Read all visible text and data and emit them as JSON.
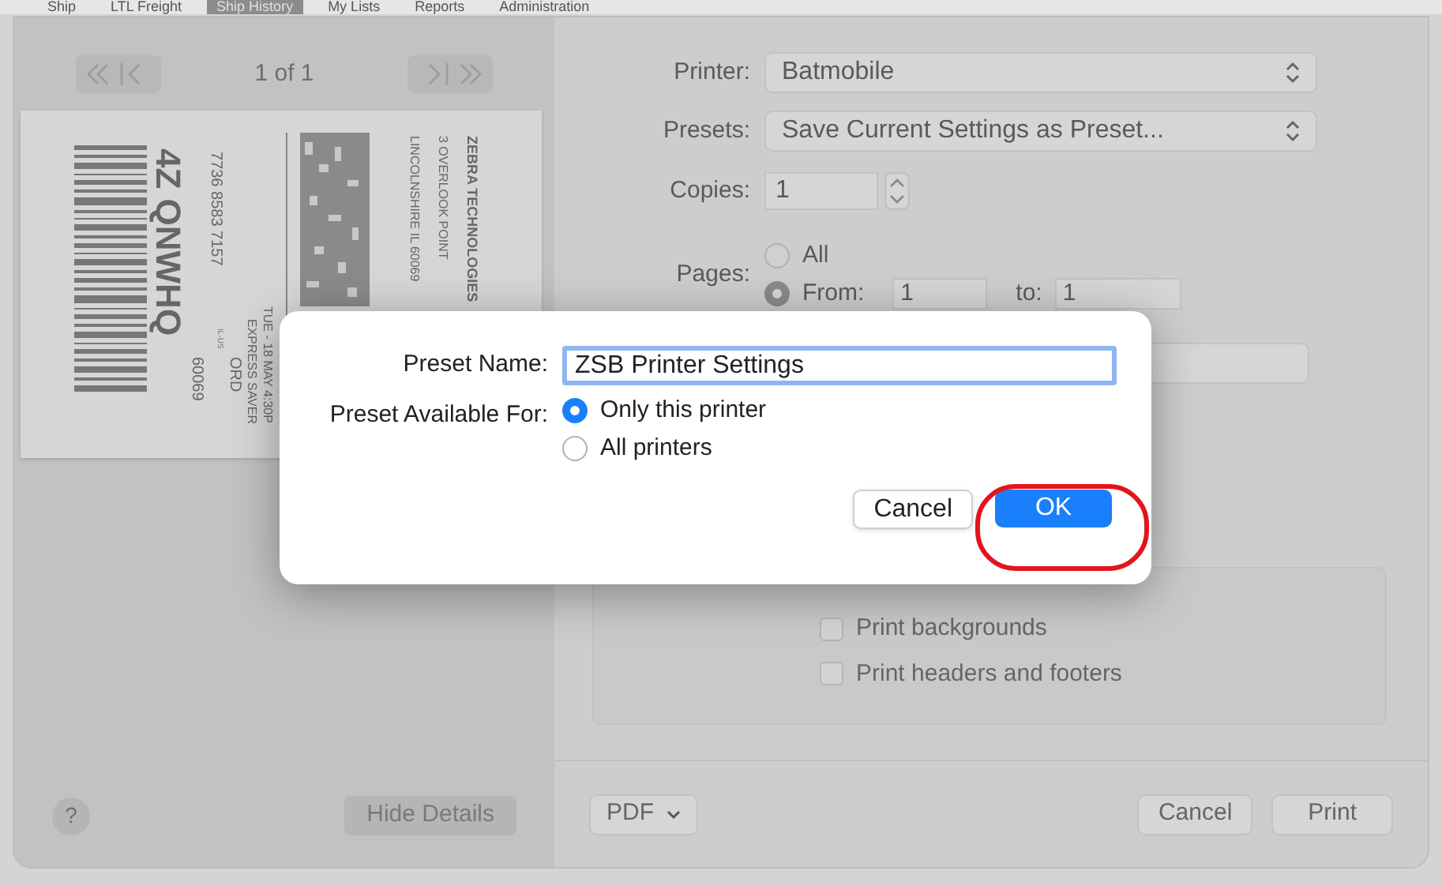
{
  "top_tabs": [
    {
      "label": "Ship",
      "selected": false
    },
    {
      "label": "LTL Freight",
      "selected": false
    },
    {
      "label": "Ship History",
      "selected": true
    },
    {
      "label": "My Lists",
      "selected": false
    },
    {
      "label": "Reports",
      "selected": false
    },
    {
      "label": "Administration",
      "selected": false
    }
  ],
  "preview": {
    "page_indicator": "1 of 1",
    "label": {
      "code": "4Z QNWHQ",
      "tracking": "7736 8583 7157",
      "date": "TUE - 18 MAY 4:30P",
      "service": "EXPRESS SAVER",
      "postal": "60069",
      "airport": "ORD",
      "region": "IL-US",
      "address": [
        "LINCOLNSHIRE IL 60069",
        "3 OVERLOOK POINT",
        "ZEBRA TECHNOLOGIES"
      ]
    },
    "help": "?",
    "hide_details": "Hide Details"
  },
  "settings": {
    "printer": {
      "label": "Printer:",
      "value": "Batmobile"
    },
    "presets": {
      "label": "Presets:",
      "value": "Save Current Settings as Preset..."
    },
    "copies": {
      "label": "Copies:",
      "value": "1"
    },
    "pages": {
      "label": "Pages:",
      "options": [
        {
          "label": "All",
          "selected": false
        },
        {
          "label": "From:",
          "selected": true
        }
      ],
      "from": "1",
      "to_label": "to:",
      "to": "1"
    },
    "options": [
      {
        "label": "Print backgrounds",
        "checked": false
      },
      {
        "label": "Print headers and footers",
        "checked": false
      }
    ]
  },
  "footer": {
    "pdf": "PDF",
    "cancel": "Cancel",
    "print": "Print"
  },
  "preset_dialog": {
    "name_label": "Preset Name:",
    "name_value": "ZSB Printer Settings",
    "available_label": "Preset Available For:",
    "options": [
      {
        "label": "Only this printer",
        "selected": true
      },
      {
        "label": "All printers",
        "selected": false
      }
    ],
    "cancel": "Cancel",
    "ok": "OK"
  }
}
